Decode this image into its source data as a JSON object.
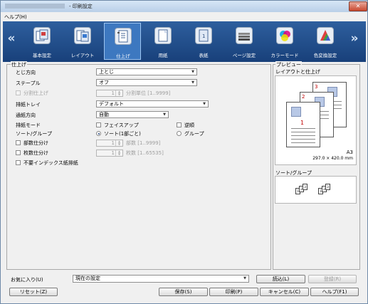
{
  "window": {
    "title": "- 印刷設定",
    "close": "✕"
  },
  "menu": {
    "help": "ヘルプ(H)"
  },
  "nav": {
    "prev": "«",
    "next": "»"
  },
  "tabs": [
    {
      "label": "基本設定"
    },
    {
      "label": "レイアウト"
    },
    {
      "label": "仕上げ"
    },
    {
      "label": "用紙"
    },
    {
      "label": "表紙"
    },
    {
      "label": "ページ設定"
    },
    {
      "label": "カラーモード"
    },
    {
      "label": "色変換設定"
    }
  ],
  "finish": {
    "group_title": "仕上げ",
    "binding_label": "とじ方向",
    "binding_value": "上とじ",
    "staple_label": "ステープル",
    "staple_value": "オフ",
    "separate_label": "分割仕上げ",
    "separate_count": "1",
    "separate_unit": "分割単位 [1..9999]",
    "output_tray_label": "排紙トレイ",
    "output_tray_value": "デフォルト",
    "feed_dir_label": "通紙方向",
    "feed_dir_value": "自動",
    "output_mode_label": "排紙モード",
    "faceup_label": "フェイスアップ",
    "reverse_label": "逆順",
    "sort_label": "ソート/グループ",
    "sort_option": "ソート(1部ごと)",
    "group_option": "グループ",
    "offset_label": "部数仕分け",
    "offset_count": "1",
    "offset_unit": "部数 [1..9999]",
    "sheet_sep_label": "枚数仕分け",
    "sheet_sep_count": "1",
    "sheet_sep_unit": "枚数 [1..65535]",
    "no_index_label": "不要インデックス紙排紙"
  },
  "preview": {
    "group_title": "プレビュー",
    "layout_label": "レイアウトと仕上げ",
    "page_numbers": [
      "3",
      "2",
      "1"
    ],
    "paper_size": "A3",
    "paper_dims": "297.0 × 420.0 mm",
    "sort_label": "ソート/グループ",
    "sort_sheets": [
      "1",
      "2",
      "3"
    ]
  },
  "favorites": {
    "label": "お気に入り(U)",
    "value": "現在の設定",
    "load": "読込(L)",
    "register": "登録(R)"
  },
  "buttons": {
    "reset": "リセット(Z)",
    "save": "保存(S)",
    "print": "印刷(P)",
    "cancel": "キャンセル(C)",
    "help": "ヘルプ(F1)"
  }
}
